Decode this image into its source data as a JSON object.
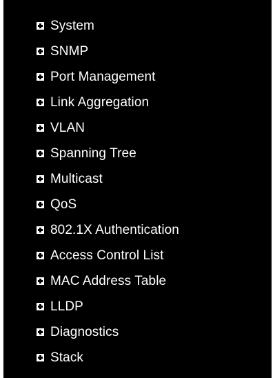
{
  "colors": {
    "panel_background": "#000000",
    "text": "#ffffff",
    "icon_fill": "#ffffff"
  },
  "menu": {
    "items": [
      {
        "label": "System",
        "icon": "expand-plus-icon"
      },
      {
        "label": "SNMP",
        "icon": "expand-plus-icon"
      },
      {
        "label": "Port Management",
        "icon": "expand-plus-icon"
      },
      {
        "label": "Link Aggregation",
        "icon": "expand-plus-icon"
      },
      {
        "label": "VLAN",
        "icon": "expand-plus-icon"
      },
      {
        "label": "Spanning Tree",
        "icon": "expand-plus-icon"
      },
      {
        "label": "Multicast",
        "icon": "expand-plus-icon"
      },
      {
        "label": "QoS",
        "icon": "expand-plus-icon"
      },
      {
        "label": "802.1X Authentication",
        "icon": "expand-plus-icon"
      },
      {
        "label": "Access Control List",
        "icon": "expand-plus-icon"
      },
      {
        "label": "MAC Address Table",
        "icon": "expand-plus-icon"
      },
      {
        "label": "LLDP",
        "icon": "expand-plus-icon"
      },
      {
        "label": "Diagnostics",
        "icon": "expand-plus-icon"
      },
      {
        "label": "Stack",
        "icon": "expand-plus-icon"
      }
    ]
  }
}
